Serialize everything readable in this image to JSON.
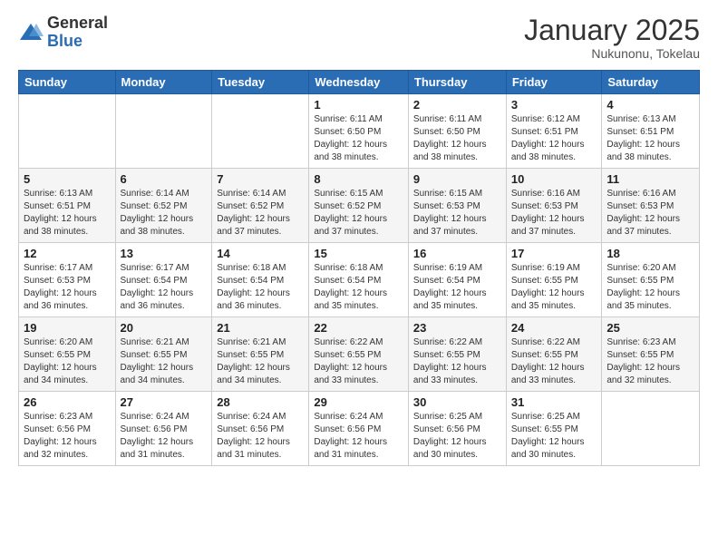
{
  "logo": {
    "general": "General",
    "blue": "Blue"
  },
  "header": {
    "month": "January 2025",
    "location": "Nukunonu, Tokelau"
  },
  "weekdays": [
    "Sunday",
    "Monday",
    "Tuesday",
    "Wednesday",
    "Thursday",
    "Friday",
    "Saturday"
  ],
  "weeks": [
    [
      {
        "day": "",
        "info": ""
      },
      {
        "day": "",
        "info": ""
      },
      {
        "day": "",
        "info": ""
      },
      {
        "day": "1",
        "info": "Sunrise: 6:11 AM\nSunset: 6:50 PM\nDaylight: 12 hours\nand 38 minutes."
      },
      {
        "day": "2",
        "info": "Sunrise: 6:11 AM\nSunset: 6:50 PM\nDaylight: 12 hours\nand 38 minutes."
      },
      {
        "day": "3",
        "info": "Sunrise: 6:12 AM\nSunset: 6:51 PM\nDaylight: 12 hours\nand 38 minutes."
      },
      {
        "day": "4",
        "info": "Sunrise: 6:13 AM\nSunset: 6:51 PM\nDaylight: 12 hours\nand 38 minutes."
      }
    ],
    [
      {
        "day": "5",
        "info": "Sunrise: 6:13 AM\nSunset: 6:51 PM\nDaylight: 12 hours\nand 38 minutes."
      },
      {
        "day": "6",
        "info": "Sunrise: 6:14 AM\nSunset: 6:52 PM\nDaylight: 12 hours\nand 38 minutes."
      },
      {
        "day": "7",
        "info": "Sunrise: 6:14 AM\nSunset: 6:52 PM\nDaylight: 12 hours\nand 37 minutes."
      },
      {
        "day": "8",
        "info": "Sunrise: 6:15 AM\nSunset: 6:52 PM\nDaylight: 12 hours\nand 37 minutes."
      },
      {
        "day": "9",
        "info": "Sunrise: 6:15 AM\nSunset: 6:53 PM\nDaylight: 12 hours\nand 37 minutes."
      },
      {
        "day": "10",
        "info": "Sunrise: 6:16 AM\nSunset: 6:53 PM\nDaylight: 12 hours\nand 37 minutes."
      },
      {
        "day": "11",
        "info": "Sunrise: 6:16 AM\nSunset: 6:53 PM\nDaylight: 12 hours\nand 37 minutes."
      }
    ],
    [
      {
        "day": "12",
        "info": "Sunrise: 6:17 AM\nSunset: 6:53 PM\nDaylight: 12 hours\nand 36 minutes."
      },
      {
        "day": "13",
        "info": "Sunrise: 6:17 AM\nSunset: 6:54 PM\nDaylight: 12 hours\nand 36 minutes."
      },
      {
        "day": "14",
        "info": "Sunrise: 6:18 AM\nSunset: 6:54 PM\nDaylight: 12 hours\nand 36 minutes."
      },
      {
        "day": "15",
        "info": "Sunrise: 6:18 AM\nSunset: 6:54 PM\nDaylight: 12 hours\nand 35 minutes."
      },
      {
        "day": "16",
        "info": "Sunrise: 6:19 AM\nSunset: 6:54 PM\nDaylight: 12 hours\nand 35 minutes."
      },
      {
        "day": "17",
        "info": "Sunrise: 6:19 AM\nSunset: 6:55 PM\nDaylight: 12 hours\nand 35 minutes."
      },
      {
        "day": "18",
        "info": "Sunrise: 6:20 AM\nSunset: 6:55 PM\nDaylight: 12 hours\nand 35 minutes."
      }
    ],
    [
      {
        "day": "19",
        "info": "Sunrise: 6:20 AM\nSunset: 6:55 PM\nDaylight: 12 hours\nand 34 minutes."
      },
      {
        "day": "20",
        "info": "Sunrise: 6:21 AM\nSunset: 6:55 PM\nDaylight: 12 hours\nand 34 minutes."
      },
      {
        "day": "21",
        "info": "Sunrise: 6:21 AM\nSunset: 6:55 PM\nDaylight: 12 hours\nand 34 minutes."
      },
      {
        "day": "22",
        "info": "Sunrise: 6:22 AM\nSunset: 6:55 PM\nDaylight: 12 hours\nand 33 minutes."
      },
      {
        "day": "23",
        "info": "Sunrise: 6:22 AM\nSunset: 6:55 PM\nDaylight: 12 hours\nand 33 minutes."
      },
      {
        "day": "24",
        "info": "Sunrise: 6:22 AM\nSunset: 6:55 PM\nDaylight: 12 hours\nand 33 minutes."
      },
      {
        "day": "25",
        "info": "Sunrise: 6:23 AM\nSunset: 6:55 PM\nDaylight: 12 hours\nand 32 minutes."
      }
    ],
    [
      {
        "day": "26",
        "info": "Sunrise: 6:23 AM\nSunset: 6:56 PM\nDaylight: 12 hours\nand 32 minutes."
      },
      {
        "day": "27",
        "info": "Sunrise: 6:24 AM\nSunset: 6:56 PM\nDaylight: 12 hours\nand 31 minutes."
      },
      {
        "day": "28",
        "info": "Sunrise: 6:24 AM\nSunset: 6:56 PM\nDaylight: 12 hours\nand 31 minutes."
      },
      {
        "day": "29",
        "info": "Sunrise: 6:24 AM\nSunset: 6:56 PM\nDaylight: 12 hours\nand 31 minutes."
      },
      {
        "day": "30",
        "info": "Sunrise: 6:25 AM\nSunset: 6:56 PM\nDaylight: 12 hours\nand 30 minutes."
      },
      {
        "day": "31",
        "info": "Sunrise: 6:25 AM\nSunset: 6:55 PM\nDaylight: 12 hours\nand 30 minutes."
      },
      {
        "day": "",
        "info": ""
      }
    ]
  ]
}
